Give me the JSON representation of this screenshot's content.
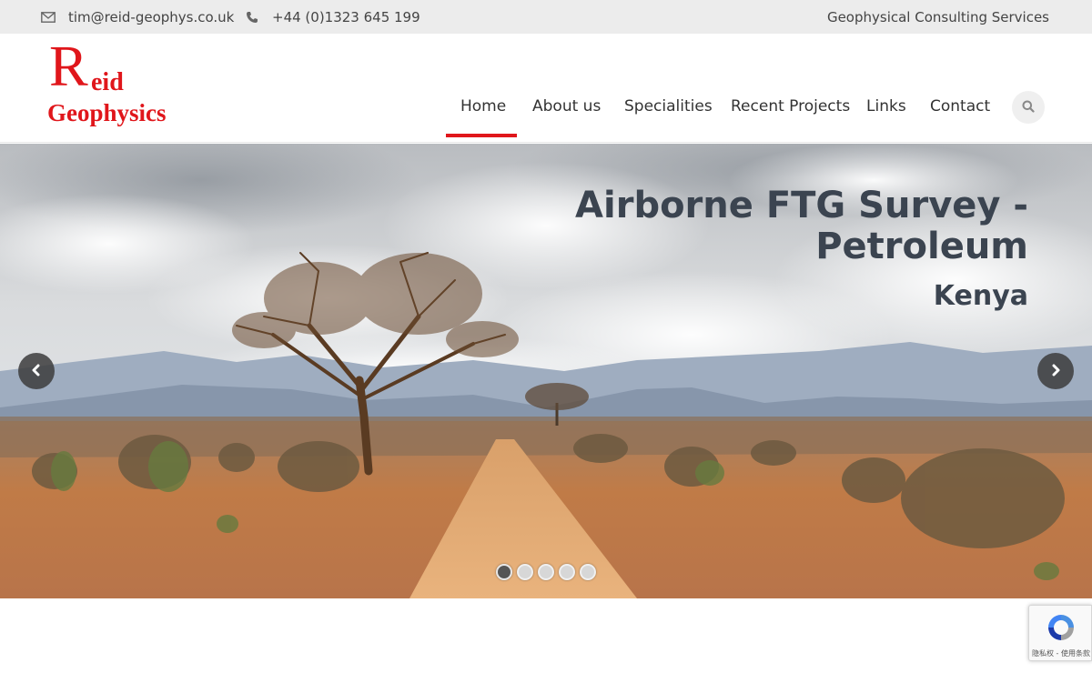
{
  "topbar": {
    "email": "tim@reid-geophys.co.uk",
    "phone": "+44 (0)1323 645 199",
    "tagline": "Geophysical Consulting Services",
    "email_icon": "envelope-icon",
    "phone_icon": "phone-icon"
  },
  "logo": {
    "big_letter": "R",
    "rest_line1": "eid",
    "line2": "Geophysics",
    "color": "#e0161b"
  },
  "nav": {
    "items": [
      {
        "label": "Home",
        "active": true
      },
      {
        "label": "About us"
      },
      {
        "label": "Specialities"
      },
      {
        "label": "Recent Projects"
      },
      {
        "label": "Links"
      },
      {
        "label": "Contact"
      }
    ],
    "search_icon": "search-icon",
    "accent": "#e0161b"
  },
  "hero": {
    "title": "Airborne FTG Survey - Petroleum",
    "subtitle": "Kenya",
    "prev_icon": "chevron-left-icon",
    "next_icon": "chevron-right-icon",
    "slide_count": 5,
    "active_slide": 1
  },
  "recaptcha": {
    "text": "隐私权 - 使用条款"
  }
}
